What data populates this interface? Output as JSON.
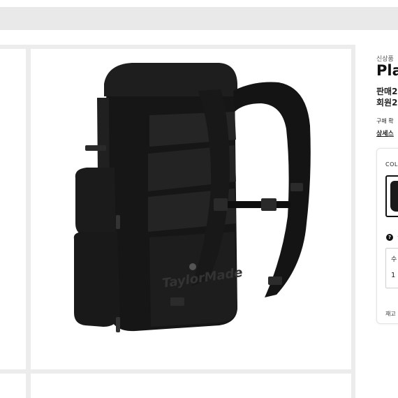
{
  "product": {
    "badge": "신상품",
    "title": "Pla",
    "line1": "판매2",
    "line2": "회원2",
    "purchase_text": "구매 확",
    "details_link": "상세스"
  },
  "options": {
    "color_label": "COL",
    "help_text": "ㅎ",
    "quantity_label": "수",
    "quantity_value": "1",
    "stock_label": "재고"
  },
  "image_text": {
    "logo_text": "TaylorMade"
  }
}
